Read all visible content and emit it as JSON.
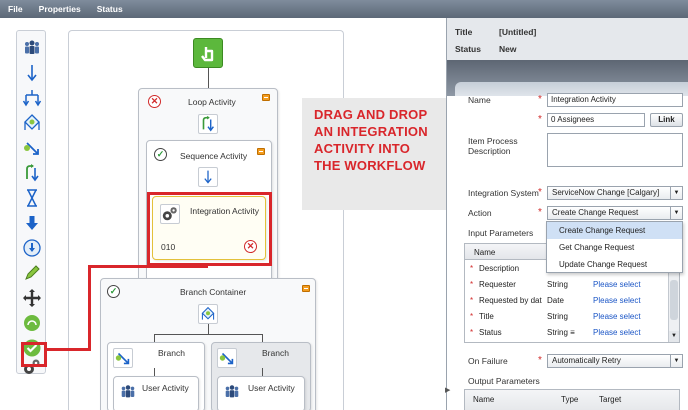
{
  "menu": {
    "items": [
      "File",
      "Properties",
      "Status"
    ]
  },
  "colors": {
    "accent_red": "#d9262b",
    "link_blue": "#1b56c6",
    "start_green": "#5cb83c",
    "orange": "#f39c1e"
  },
  "toolbar": {
    "icons": [
      "people-icon",
      "sequence-arrow-icon",
      "parallel-arrows-icon",
      "branch-diamond-icon",
      "branch-icon",
      "loop-icon",
      "hourglass-icon",
      "download-icon",
      "edit-icon",
      "move-icon",
      "recycle-icon",
      "check-icon",
      "integration-gears-icon"
    ]
  },
  "workflow": {
    "loop_activity": "Loop Activity",
    "sequence_activity": "Sequence Activity",
    "integration_activity": "Integration Activity",
    "integration_id": "010",
    "branch_container": "Branch Container",
    "branch_1": "Branch",
    "branch_2": "Branch",
    "user_activity_1": "User Activity",
    "user_activity_2": "User Activity"
  },
  "callout": {
    "lines": [
      "DRAG AND DROP",
      "AN INTEGRATION",
      "ACTIVITY INTO",
      "THE WORKFLOW"
    ]
  },
  "panel": {
    "title_label": "Title",
    "title_value": "[Untitled]",
    "status_label": "Status",
    "status_value": "New",
    "name_label": "Name",
    "name_value": "Integration Activity",
    "assignees_value": "0 Assignees",
    "link_button": "Link",
    "description_label_1": "Item Process",
    "description_label_2": "Description",
    "integration_system_label": "Integration System",
    "integration_system_value": "ServiceNow Change [Calgary]",
    "action_label": "Action",
    "action_value": "Create Change Request",
    "action_options": [
      "Create Change Request",
      "Get Change Request",
      "Update Change Request"
    ],
    "input_parameters_label": "Input Parameters",
    "table_header_name": "Name",
    "input_rows": [
      {
        "name": "Description",
        "type": "",
        "target": ""
      },
      {
        "name": "Requester",
        "type": "String",
        "target": "Please select"
      },
      {
        "name": "Requested by dat",
        "type": "Date",
        "target": "Please select"
      },
      {
        "name": "Title",
        "type": "String",
        "target": "Please select"
      },
      {
        "name": "Status",
        "type": "String ≡",
        "target": "Please select"
      }
    ],
    "on_failure_label": "On Failure",
    "on_failure_value": "Automatically Retry",
    "output_parameters_label": "Output Parameters",
    "output_headers": [
      "Name",
      "Type",
      "Target"
    ]
  }
}
